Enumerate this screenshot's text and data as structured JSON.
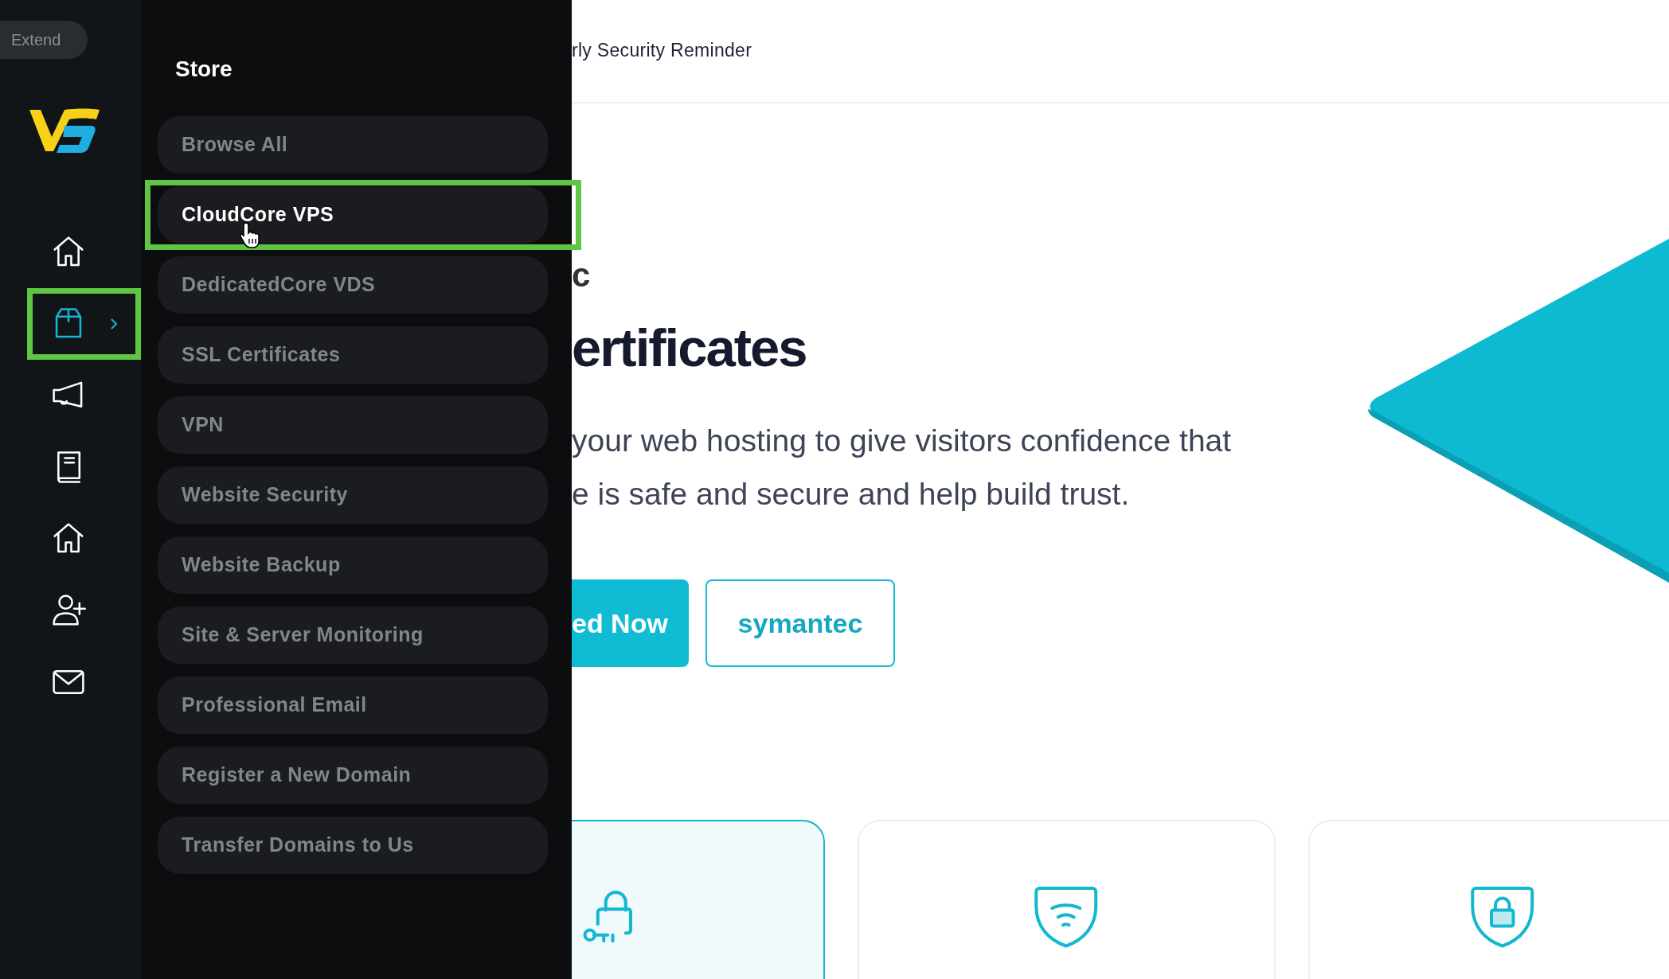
{
  "rail": {
    "extend_label": "Extend",
    "items": [
      {
        "selected": false,
        "highlighted": false
      },
      {
        "selected": true,
        "highlighted": true
      },
      {
        "selected": false,
        "highlighted": false
      },
      {
        "selected": false,
        "highlighted": false
      },
      {
        "selected": false,
        "highlighted": false
      },
      {
        "selected": false,
        "highlighted": false
      },
      {
        "selected": false,
        "highlighted": false
      }
    ]
  },
  "menu": {
    "title": "Store",
    "items": [
      {
        "label": "Browse All",
        "selected": false,
        "highlighted": false
      },
      {
        "label": "CloudCore VPS",
        "selected": true,
        "highlighted": true
      },
      {
        "label": "DedicatedCore VDS",
        "selected": false,
        "highlighted": false
      },
      {
        "label": "SSL Certificates",
        "selected": false,
        "highlighted": false
      },
      {
        "label": "VPN",
        "selected": false,
        "highlighted": false
      },
      {
        "label": "Website Security",
        "selected": false,
        "highlighted": false
      },
      {
        "label": "Website Backup",
        "selected": false,
        "highlighted": false
      },
      {
        "label": "Site & Server Monitoring",
        "selected": false,
        "highlighted": false
      },
      {
        "label": "Professional Email",
        "selected": false,
        "highlighted": false
      },
      {
        "label": "Register a New Domain",
        "selected": false,
        "highlighted": false
      },
      {
        "label": "Transfer Domains to Us",
        "selected": false,
        "highlighted": false
      }
    ]
  },
  "header": {
    "text": "rly Security Reminder"
  },
  "hero": {
    "logo_text": "c",
    "title": "ertificates",
    "description_lines": [
      "your web hosting to give visitors confidence that",
      "e is safe and secure and help build trust."
    ],
    "buttons": [
      {
        "label": "ed Now",
        "kind": "primary"
      },
      {
        "label": "symantec",
        "kind": "outline"
      }
    ]
  },
  "cards": [
    {
      "selected": true
    },
    {
      "selected": false
    },
    {
      "selected": false
    }
  ]
}
